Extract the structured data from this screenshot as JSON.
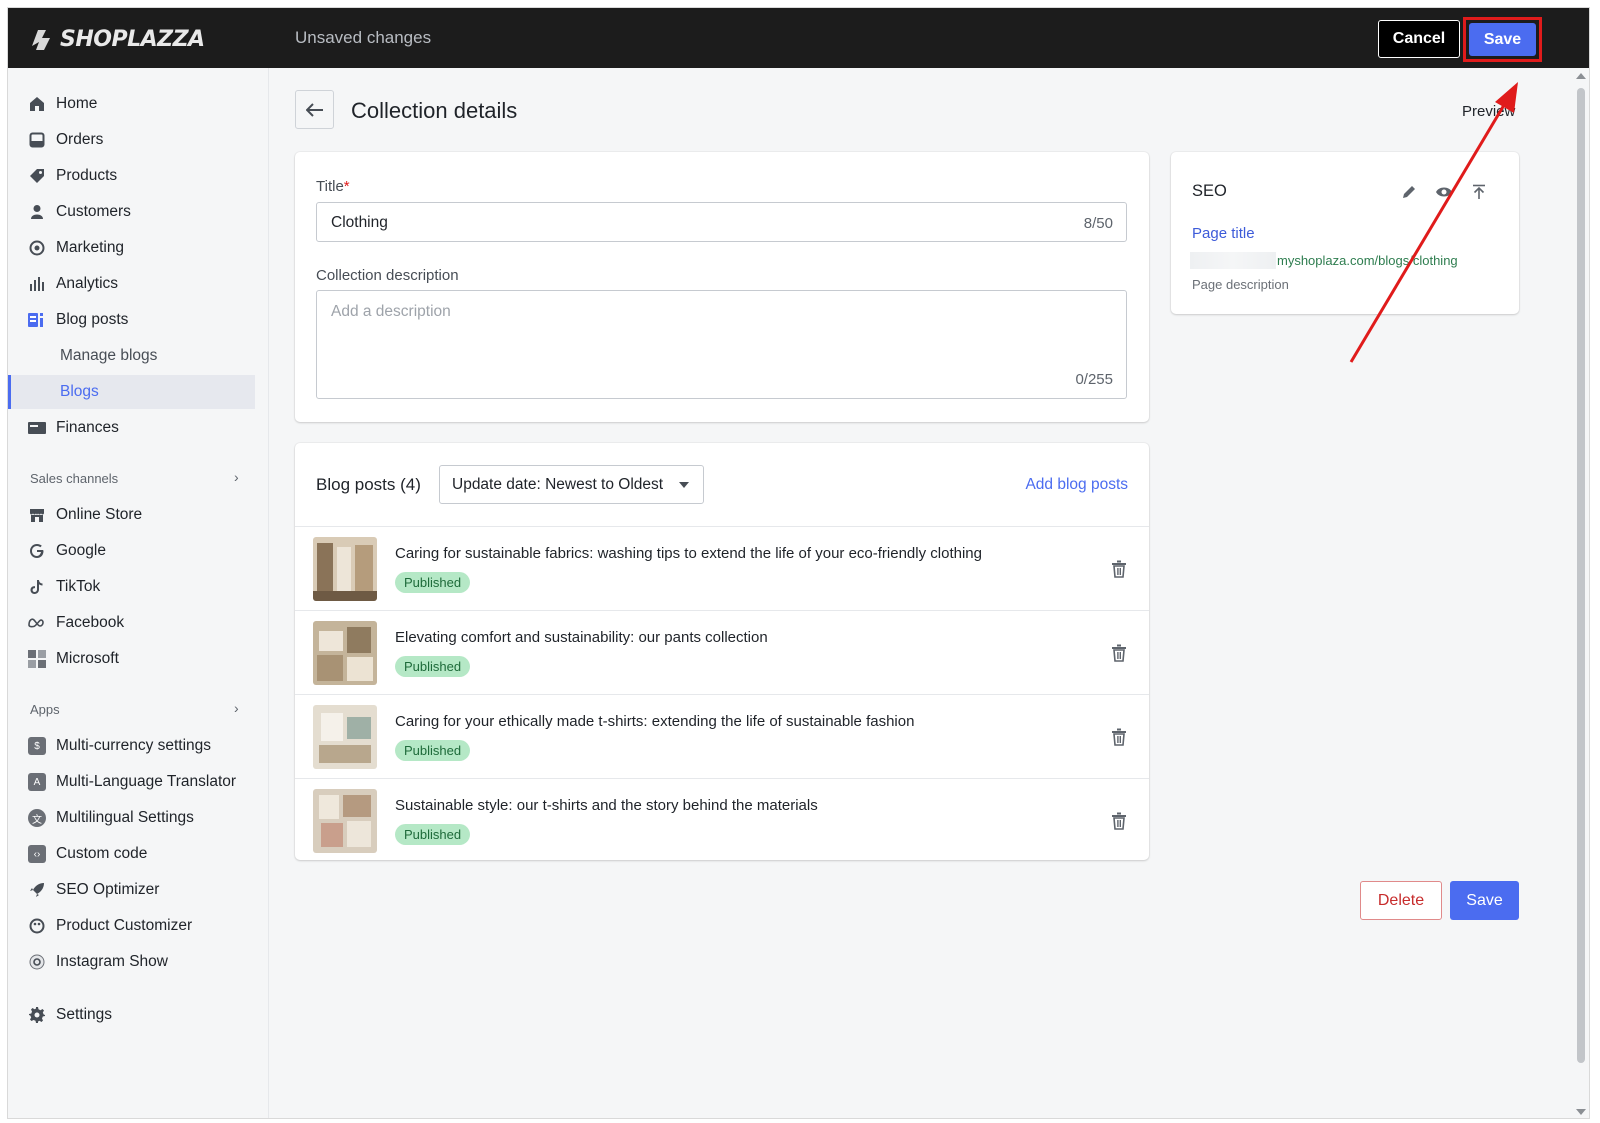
{
  "topbar": {
    "logo_text": "SHOPLAZZA",
    "status": "Unsaved changes",
    "cancel_label": "Cancel",
    "save_label": "Save"
  },
  "sidebar": {
    "items": [
      {
        "label": "Home",
        "icon": "home-icon"
      },
      {
        "label": "Orders",
        "icon": "inbox-icon"
      },
      {
        "label": "Products",
        "icon": "tag-icon"
      },
      {
        "label": "Customers",
        "icon": "person-icon"
      },
      {
        "label": "Marketing",
        "icon": "target-icon"
      },
      {
        "label": "Analytics",
        "icon": "bar-chart-icon"
      },
      {
        "label": "Blog posts",
        "icon": "blog-icon"
      },
      {
        "label": "Manage blogs"
      },
      {
        "label": "Blogs"
      },
      {
        "label": "Finances",
        "icon": "wallet-icon"
      }
    ],
    "sales_channels_heading": "Sales channels",
    "sales_channels": [
      {
        "label": "Online Store",
        "icon": "store-icon"
      },
      {
        "label": "Google",
        "icon": "google-icon"
      },
      {
        "label": "TikTok",
        "icon": "tiktok-icon"
      },
      {
        "label": "Facebook",
        "icon": "meta-icon"
      },
      {
        "label": "Microsoft",
        "icon": "microsoft-icon"
      }
    ],
    "apps_heading": "Apps",
    "apps": [
      {
        "label": "Multi-currency settings",
        "icon": "currency-app-icon"
      },
      {
        "label": "Multi-Language Translator",
        "icon": "translate-app-icon"
      },
      {
        "label": "Multilingual Settings",
        "icon": "language-app-icon"
      },
      {
        "label": "Custom code",
        "icon": "code-app-icon"
      },
      {
        "label": "SEO Optimizer",
        "icon": "rocket-icon"
      },
      {
        "label": "Product Customizer",
        "icon": "palette-icon"
      },
      {
        "label": "Instagram Show",
        "icon": "instagram-icon"
      }
    ],
    "settings_label": "Settings"
  },
  "page": {
    "title": "Collection details",
    "preview_label": "Preview"
  },
  "form": {
    "title_label": "Title",
    "title_required_mark": "*",
    "title_value": "Clothing",
    "title_counter": "8/50",
    "description_label": "Collection description",
    "description_placeholder": "Add a description",
    "description_counter": "0/255"
  },
  "blog_posts": {
    "heading": "Blog posts (4)",
    "sort_value": "Update date: Newest to Oldest",
    "add_label": "Add blog posts",
    "rows": [
      {
        "title": "Caring for sustainable fabrics: washing tips to extend the life of your eco-friendly clothing",
        "status": "Published"
      },
      {
        "title": "Elevating comfort and sustainability: our pants collection",
        "status": "Published"
      },
      {
        "title": "Caring for your ethically made t-shirts: extending the life of sustainable fashion",
        "status": "Published"
      },
      {
        "title": "Sustainable style: our t-shirts and the story behind the materials",
        "status": "Published"
      }
    ]
  },
  "seo": {
    "heading": "SEO",
    "page_title": "Page title",
    "url": "myshoplaza.com/blogs/clothing",
    "page_description": "Page description"
  },
  "footer": {
    "delete_label": "Delete",
    "save_label": "Save"
  },
  "colors": {
    "accent": "#4b6cf0",
    "highlight_red": "#e01b1b",
    "published_badge": "#b5e8c6"
  }
}
